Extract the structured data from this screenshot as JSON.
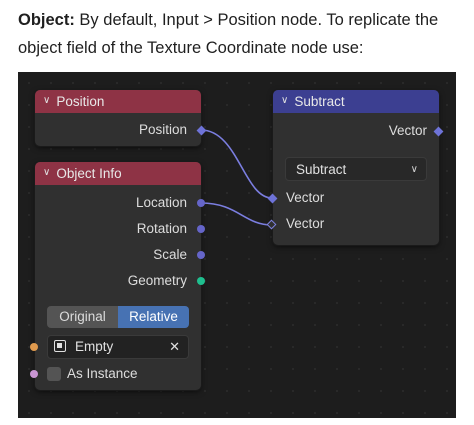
{
  "caption": {
    "bold": "Object:",
    "text": " By default, Input > Position node. To replicate the object field of the Texture Coordinate node use:"
  },
  "nodes": {
    "position": {
      "title": "Position",
      "outputs": [
        "Position"
      ]
    },
    "object_info": {
      "title": "Object Info",
      "outputs": [
        "Location",
        "Rotation",
        "Scale",
        "Geometry"
      ],
      "mode_options": [
        "Original",
        "Relative"
      ],
      "mode_selected": "Relative",
      "object_value": "Empty",
      "clear_glyph": "✕",
      "as_instance_label": "As Instance"
    },
    "subtract": {
      "title": "Subtract",
      "output": "Vector",
      "operation": "Subtract",
      "inputs": [
        "Vector",
        "Vector"
      ]
    }
  },
  "glyphs": {
    "collapse": "∨",
    "dropdown": "∨"
  },
  "colors": {
    "input_node_header": "#8e3345",
    "vector_node_header": "#3c3f91",
    "vector_socket": "#6565c9",
    "geometry_socket": "#1fbf8f",
    "selected_option": "#4772b3",
    "link": "#7b7ee0"
  },
  "icons": {
    "collapse": "chevron-down-icon",
    "object": "object-square-icon",
    "clear": "close-icon"
  }
}
